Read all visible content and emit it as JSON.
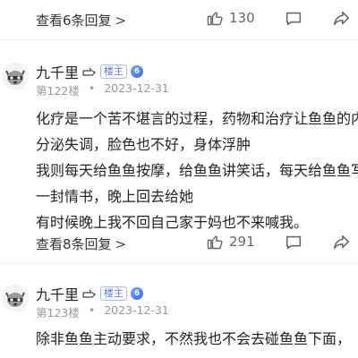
{
  "top_reply_bar": {
    "view_replies": "查看6条回复",
    "like_count": "130"
  },
  "post_122": {
    "user_name": "九千里",
    "owner_badge": "楼主",
    "level": "6",
    "floor": "第122楼",
    "date": "2023-12-31",
    "lines": [
      "化疗是一个苦不堪言的过程，药物和治疗让鱼鱼的内",
      "分泌失调，脸色也不好，身体浮肿",
      "我则每天给鱼鱼按摩，给鱼鱼讲笑话，每天给鱼鱼写",
      "一封情书，晚上回去给她",
      "有时候晚上我不回自己家于妈也不来喊我。"
    ],
    "view_replies": "查看8条回复",
    "like_count": "291"
  },
  "post_123": {
    "user_name": "九千里",
    "owner_badge": "楼主",
    "level": "6",
    "floor": "第123楼",
    "date": "2023-12-31",
    "lines": [
      "除非鱼鱼主动要求，不然我也不会去碰鱼鱼下面，"
    ]
  },
  "colors": {
    "muted_text": "#999999",
    "badge_blue": "#5a7bd8",
    "divider": "#ececec"
  },
  "icons": [
    "hand-icon",
    "thumbs-up-icon",
    "comment-icon",
    "share-icon",
    "chevron-right-icon",
    "raccoon-avatar"
  ]
}
